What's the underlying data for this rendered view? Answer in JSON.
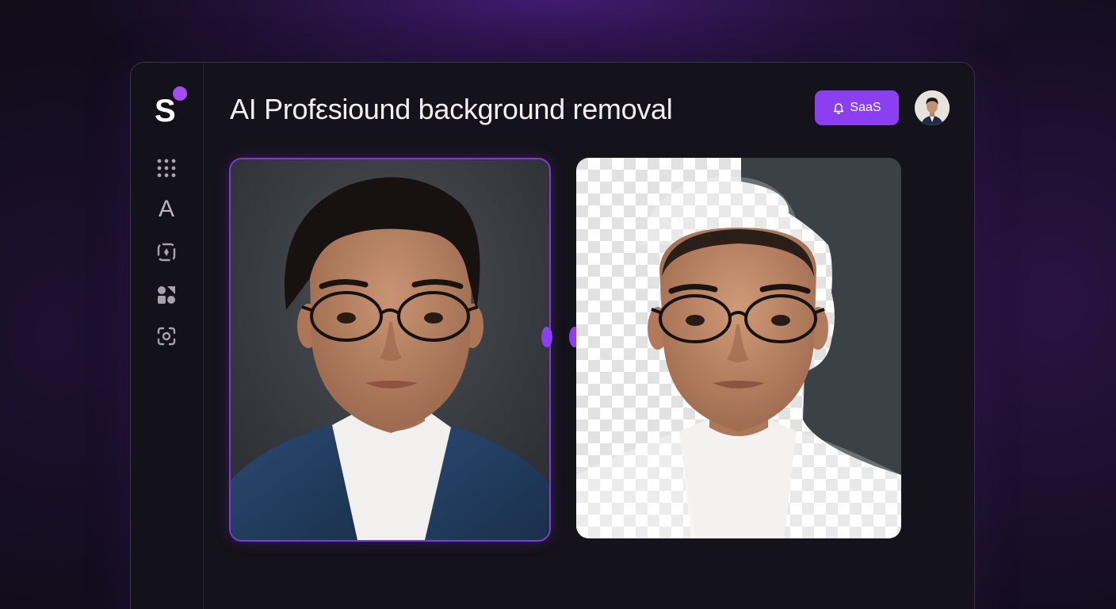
{
  "header": {
    "title": "AI Profεsiound background removal",
    "badge_label": "SaaS"
  },
  "sidebar": {
    "logo_letter": "S",
    "items": [
      {
        "icon": "apps-grid-icon"
      },
      {
        "icon": "text-letter-icon",
        "label": "A"
      },
      {
        "icon": "frame-icon"
      },
      {
        "icon": "shapes-icon"
      },
      {
        "icon": "focus-icon"
      }
    ]
  },
  "panels": {
    "original": {
      "subject": "portrait photo with dark gray background"
    },
    "result": {
      "subject": "portrait with background removed (transparent checkerboard)"
    }
  },
  "colors": {
    "accent": "#8a3ff0",
    "window_bg": "#14121a",
    "page_bg": "#0d0b13",
    "checker_light": "#ffffff",
    "checker_dark": "#e3e3e3"
  }
}
